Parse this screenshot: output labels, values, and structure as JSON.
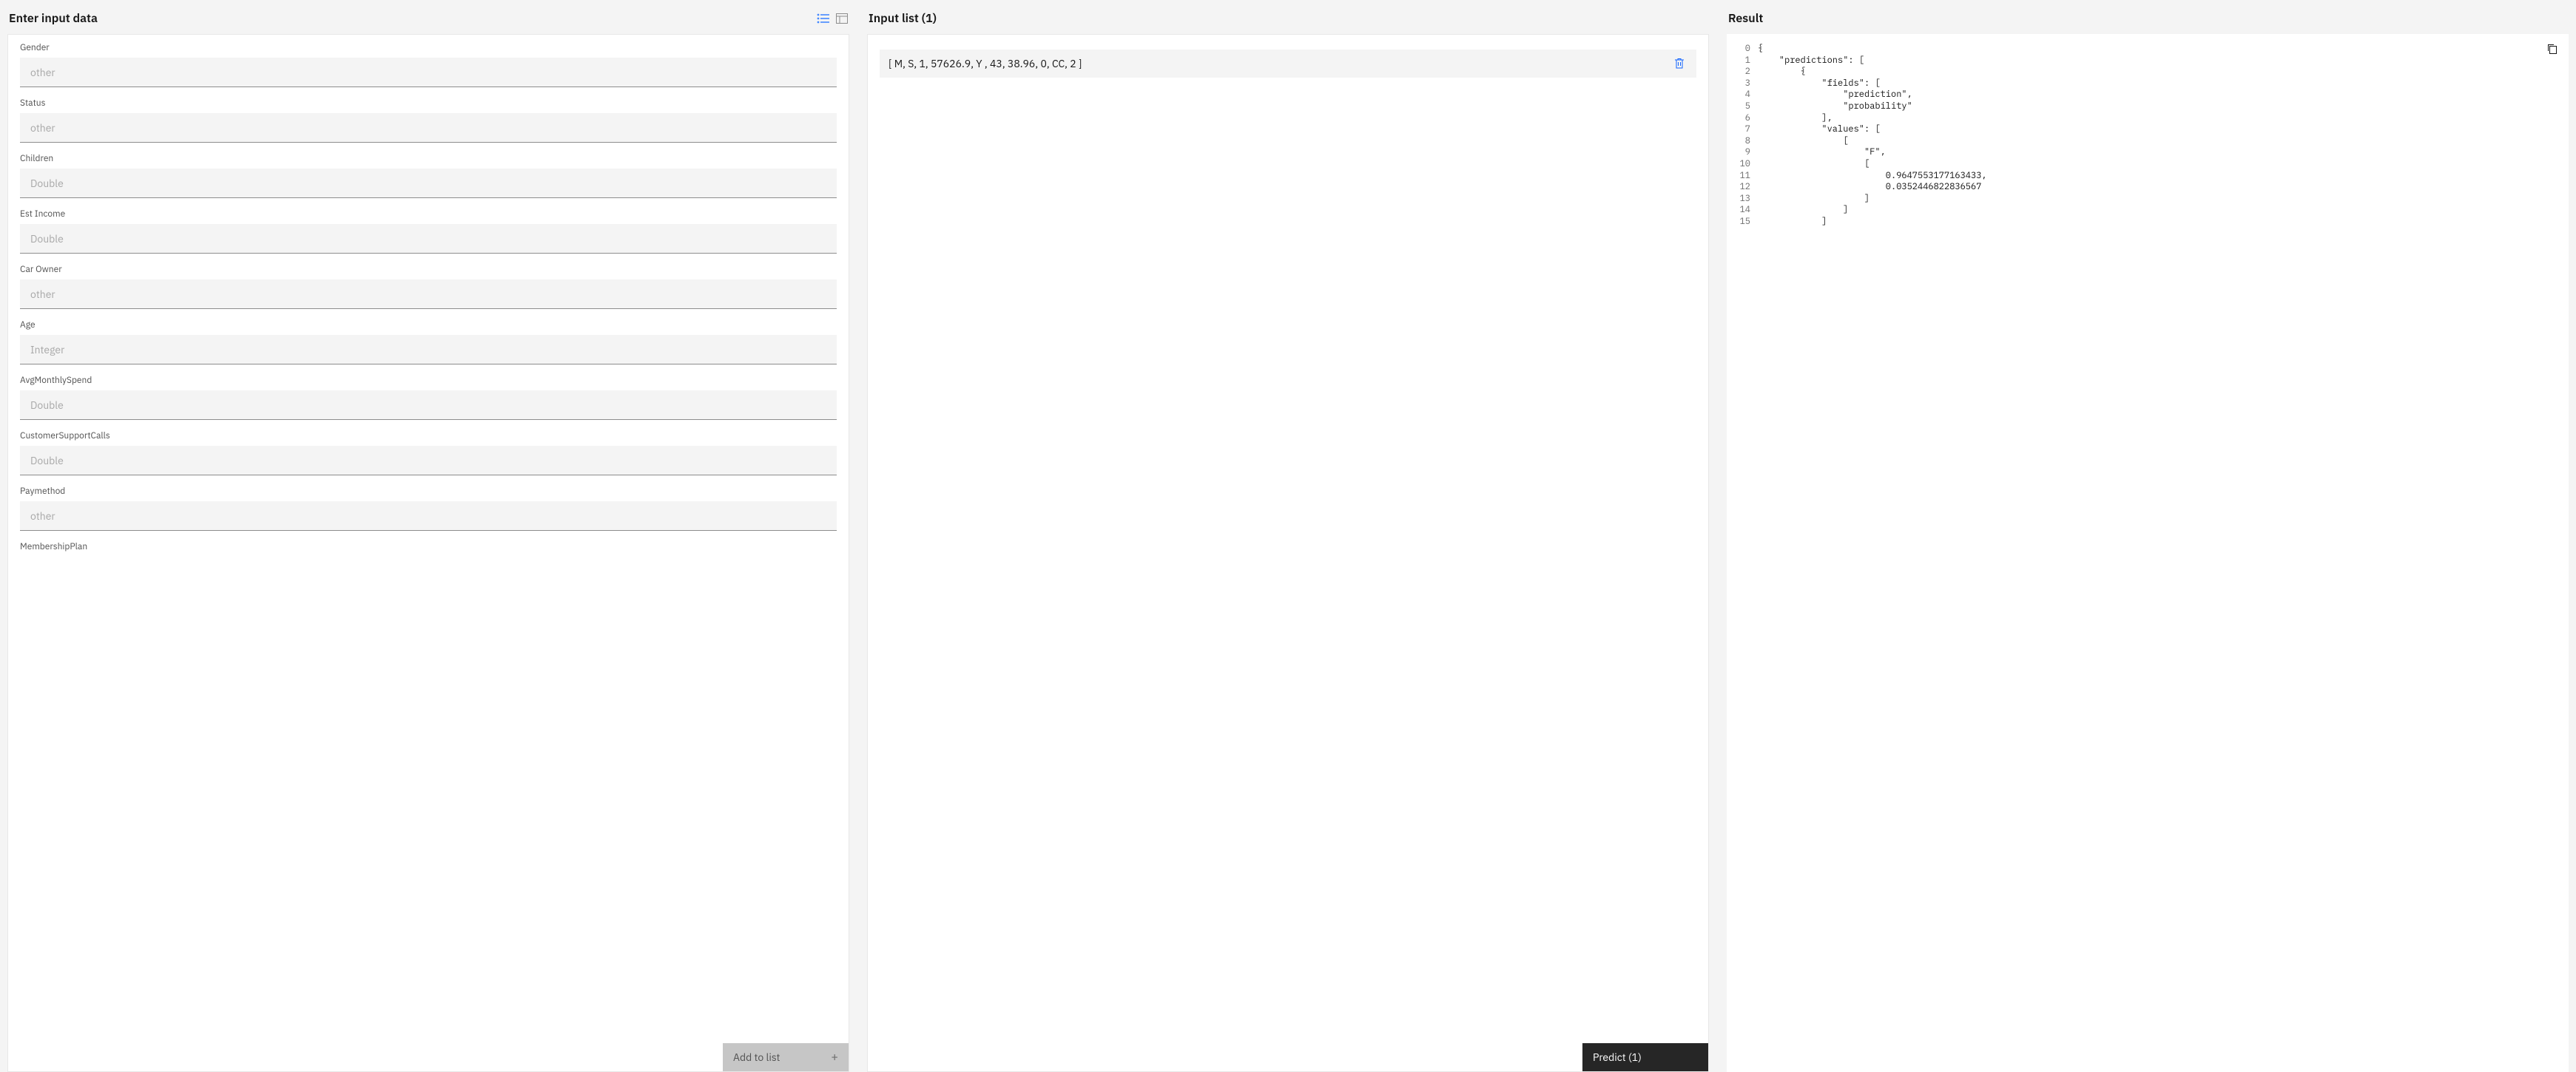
{
  "input_panel": {
    "title": "Enter input data",
    "add_button_label": "Add to list",
    "fields": [
      {
        "label": "Gender",
        "placeholder": "other"
      },
      {
        "label": "Status",
        "placeholder": "other"
      },
      {
        "label": "Children",
        "placeholder": "Double"
      },
      {
        "label": "Est Income",
        "placeholder": "Double"
      },
      {
        "label": "Car Owner",
        "placeholder": "other"
      },
      {
        "label": "Age",
        "placeholder": "Integer"
      },
      {
        "label": "AvgMonthlySpend",
        "placeholder": "Double"
      },
      {
        "label": "CustomerSupportCalls",
        "placeholder": "Double"
      },
      {
        "label": "Paymethod",
        "placeholder": "other"
      },
      {
        "label": "MembershipPlan",
        "placeholder": ""
      }
    ]
  },
  "list_panel": {
    "title": "Input list (1)",
    "predict_label": "Predict (1)",
    "rows": [
      "[ M, S, 1, 57626.9, Y , 43, 38.96, 0, CC, 2 ]"
    ]
  },
  "result_panel": {
    "title": "Result",
    "lines": [
      "{",
      "    \"predictions\": [",
      "        {",
      "            \"fields\": [",
      "                \"prediction\",",
      "                \"probability\"",
      "            ],",
      "            \"values\": [",
      "                [",
      "                    \"F\",",
      "                    [",
      "                        0.9647553177163433,",
      "                        0.0352446822836567",
      "                    ]",
      "                ]",
      "            ]"
    ],
    "start_line": 0
  }
}
